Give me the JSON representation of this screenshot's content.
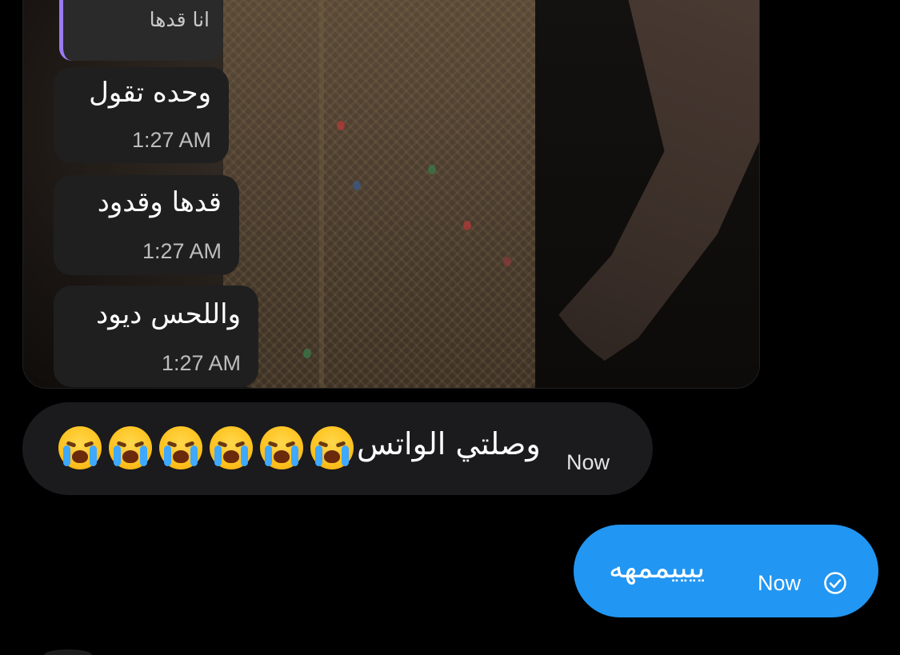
{
  "shared_screenshot": {
    "reply_preview": "انا قدها",
    "messages": [
      {
        "text": "وحده تقول",
        "time": "1:27 AM"
      },
      {
        "text": "قدها وقدود",
        "time": "1:27 AM"
      },
      {
        "text": "واللحس ديود",
        "time": "1:27 AM"
      }
    ]
  },
  "received_message": {
    "text": "وصلتي الواتس",
    "emoji": "loudly-crying-face",
    "emoji_count": 6,
    "time": "Now"
  },
  "sent_message": {
    "text": "ييييممهه",
    "time": "Now",
    "status_icon": "check-circle-icon"
  },
  "colors": {
    "background": "#000000",
    "received_bubble": "#1b1b1d",
    "sent_bubble": "#2196f3",
    "reply_accent": "#9b7bf0"
  }
}
